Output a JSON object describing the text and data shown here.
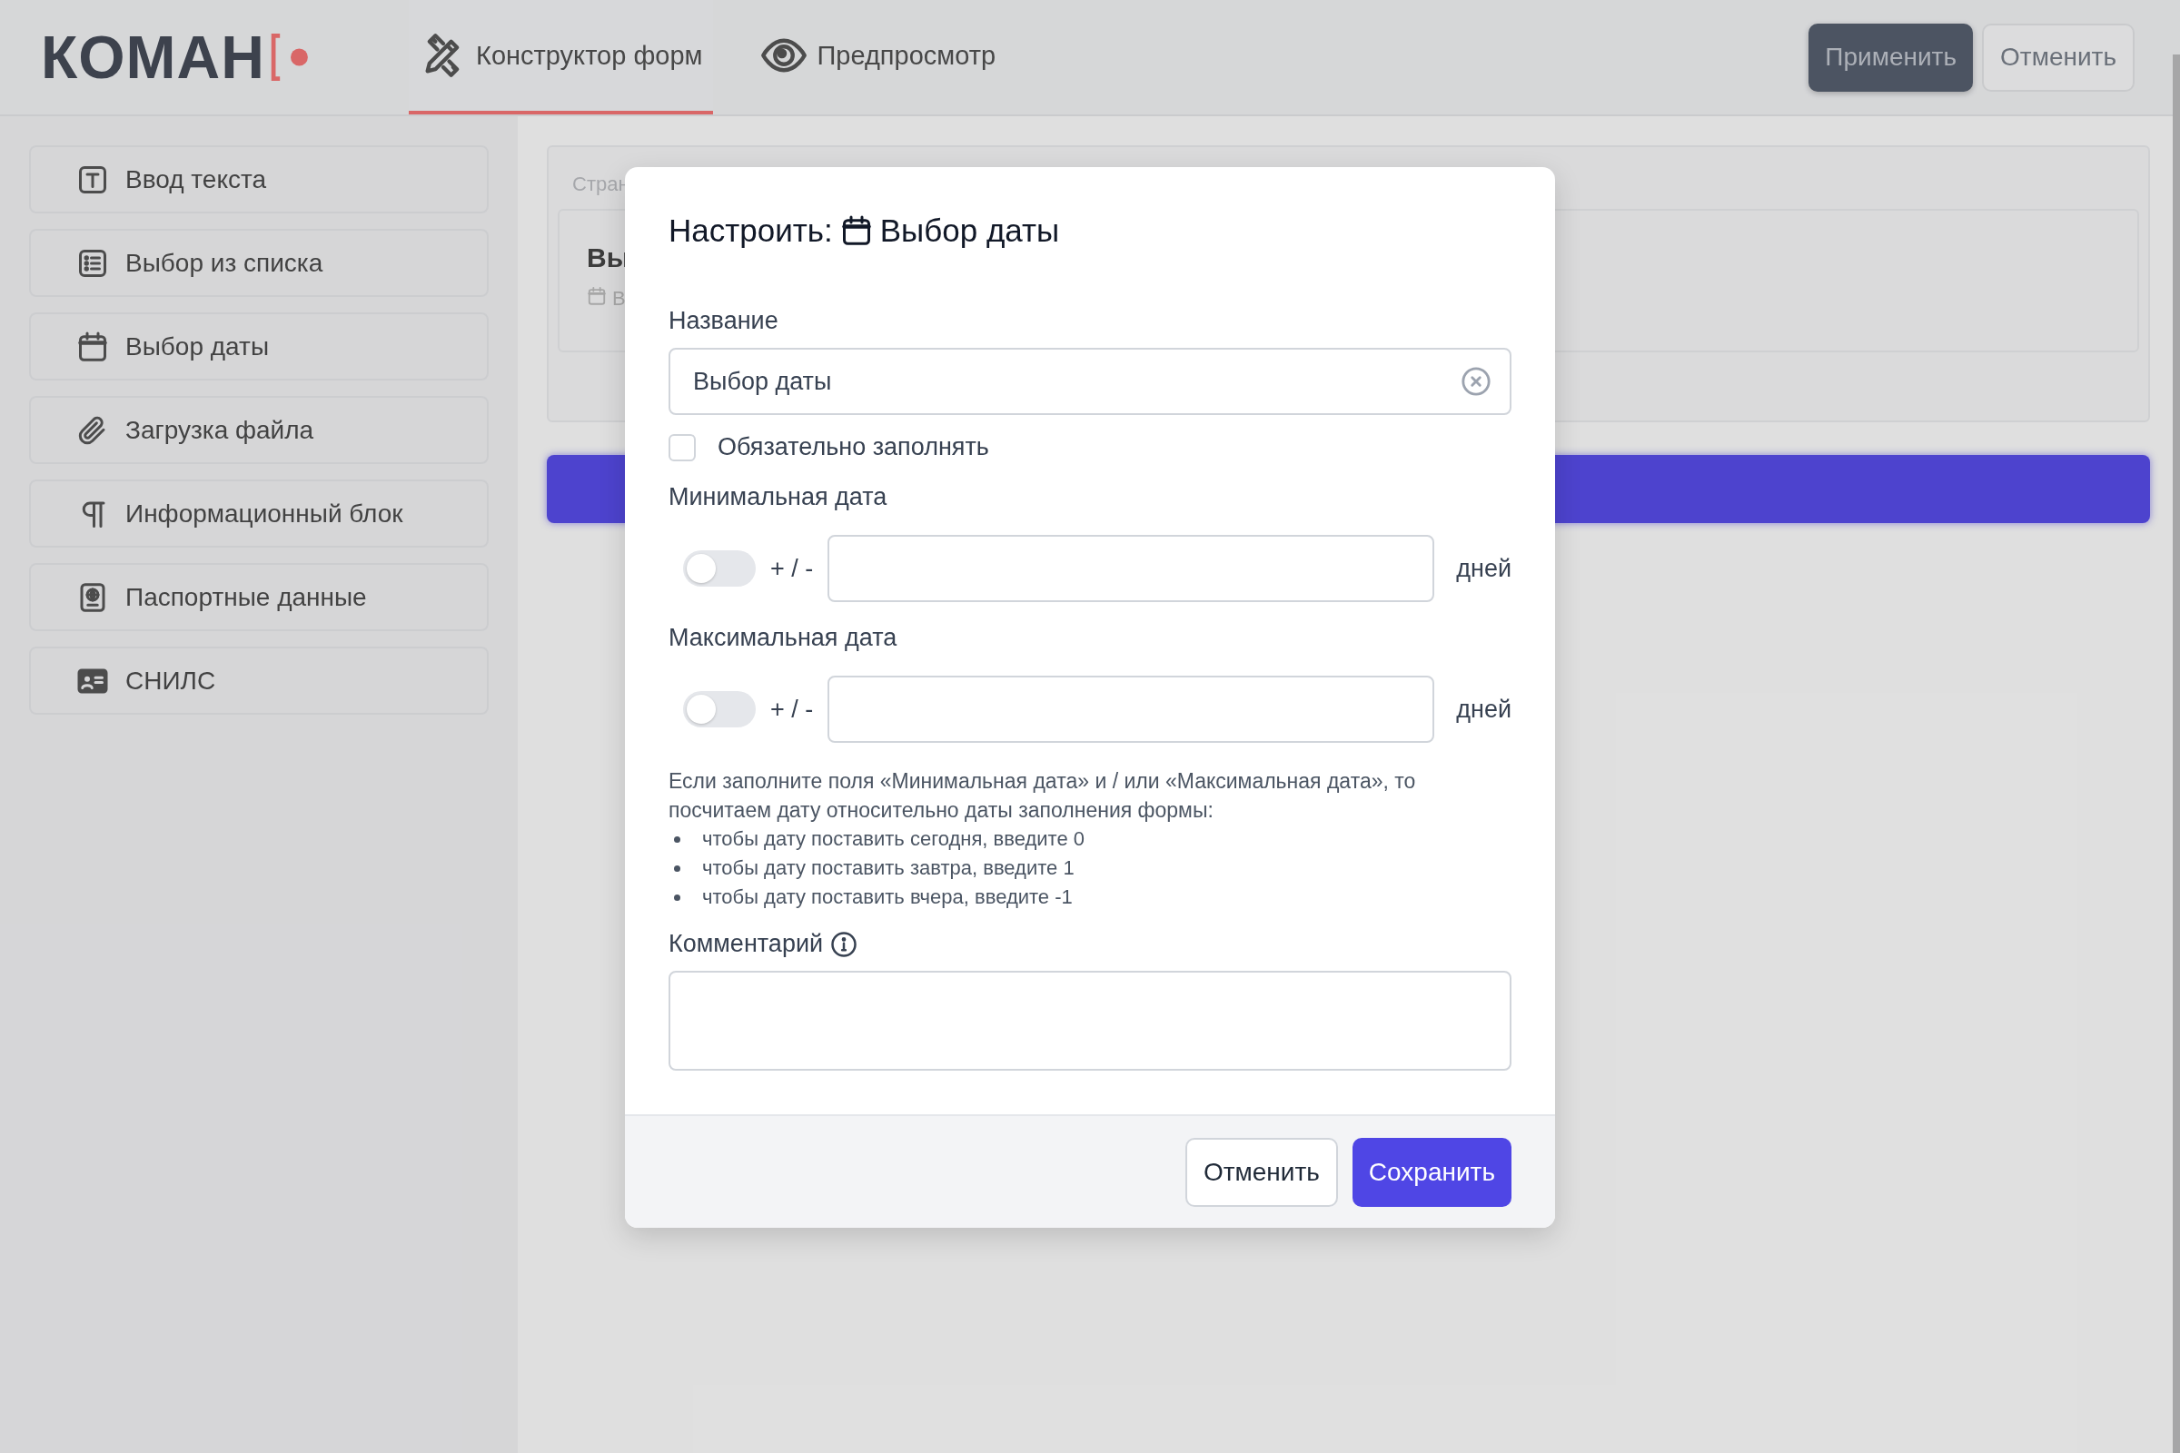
{
  "header": {
    "logo": {
      "text": "КОМАН"
    },
    "tabs": [
      {
        "label": "Конструктор форм",
        "kind": "builder",
        "selected": true
      },
      {
        "label": "Предпросмотр",
        "kind": "preview",
        "selected": false
      }
    ],
    "buttons": [
      {
        "label": "Применить",
        "kind": "primary"
      },
      {
        "label": "Отменить",
        "kind": "secondary"
      }
    ]
  },
  "sidebar": {
    "items": [
      {
        "label": "Ввод текста",
        "kind": "text"
      },
      {
        "label": "Выбор из списка",
        "kind": "list"
      },
      {
        "label": "Выбор даты",
        "kind": "date"
      },
      {
        "label": "Загрузка файла",
        "kind": "file"
      },
      {
        "label": "Информационный блок",
        "kind": "paragraph"
      },
      {
        "label": "Паспортные данные",
        "kind": "passport"
      },
      {
        "label": "СНИЛС",
        "kind": "snils"
      }
    ]
  },
  "canvas": {
    "page_label": "Стран",
    "field_title": "Вы",
    "field_hint": "В"
  },
  "dialog": {
    "title": "Настроить:",
    "title_text": "Выбор даты",
    "name_label": "Название",
    "name_value": "Выбор даты",
    "required": {
      "label": "Обязательно заполнять",
      "checked": false
    },
    "ranges": [
      {
        "label": "Минимальная дата",
        "on": false,
        "sign": "+ / -",
        "unit": "дней"
      },
      {
        "label": "Максимальная дата",
        "on": false,
        "sign": "+ / -",
        "unit": "дней"
      }
    ],
    "help": {
      "text": "Если заполните поля «Минимальная дата» и / или «Максимальная дата», то посчитаем дату относительно даты заполнения формы:",
      "bullets": [
        "чтобы дату поставить сегодня, введите 0",
        "чтобы дату поставить завтра, введите 1",
        "чтобы дату поставить вчера, введите -1"
      ]
    },
    "comment_label": "Комментарий",
    "buttons": [
      {
        "label": "Отменить",
        "kind": "secondary"
      },
      {
        "label": "Сохранить",
        "kind": "primary"
      }
    ]
  }
}
